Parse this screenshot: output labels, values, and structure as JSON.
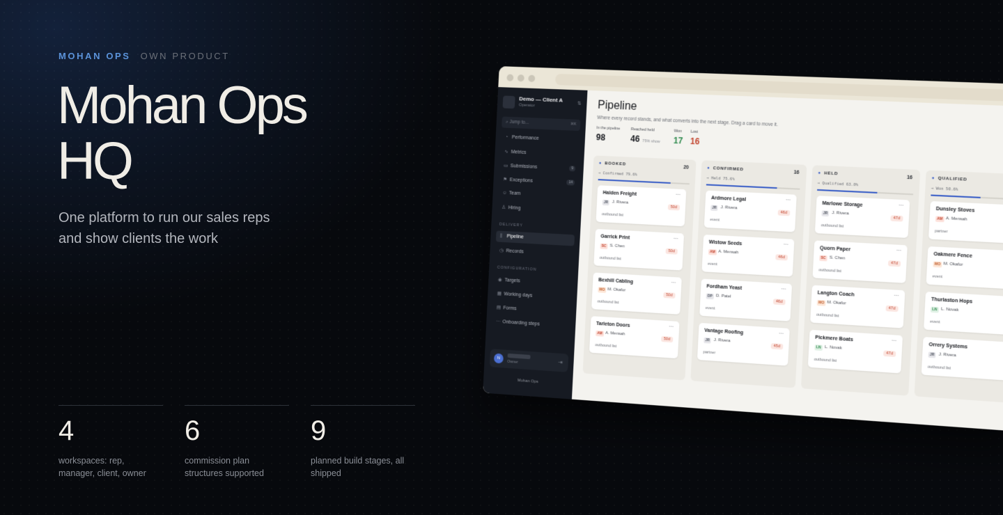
{
  "eyebrow": {
    "brand": "MOHAN OPS",
    "tag": "OWN PRODUCT"
  },
  "hero": {
    "title_line1": "Mohan Ops",
    "title_line2": "HQ",
    "subtitle": "One platform to run our sales reps and show clients the work"
  },
  "stats": [
    {
      "value": "4",
      "label": "workspaces: rep, manager, client, owner"
    },
    {
      "value": "6",
      "label": "commission plan structures supported"
    },
    {
      "value": "9",
      "label": "planned build stages, all shipped"
    }
  ],
  "app": {
    "workspace": {
      "name": "Demo — Client A",
      "role": "Operator"
    },
    "jump_placeholder": "Jump to...",
    "jump_shortcut": "⌘K",
    "nav_top": [
      {
        "label": "Performance",
        "icon": "gauge-icon",
        "glyph": "◔"
      },
      {
        "label": "Metrics",
        "icon": "activity-icon",
        "glyph": "∿"
      },
      {
        "label": "Submissions",
        "icon": "inbox-icon",
        "glyph": "▭",
        "count": "9"
      },
      {
        "label": "Exceptions",
        "icon": "flag-icon",
        "glyph": "⚑",
        "count": "14"
      },
      {
        "label": "Team",
        "icon": "users-icon",
        "glyph": "☺"
      },
      {
        "label": "Hiring",
        "icon": "user-plus-icon",
        "glyph": "♙"
      }
    ],
    "section_delivery": "DELIVERY",
    "nav_delivery": [
      {
        "label": "Pipeline",
        "icon": "kanban-icon",
        "glyph": "⫼",
        "active": true
      },
      {
        "label": "Records",
        "icon": "records-icon",
        "glyph": "◷"
      }
    ],
    "section_config": "CONFIGURATION",
    "nav_config": [
      {
        "label": "Targets",
        "icon": "target-icon",
        "glyph": "◉"
      },
      {
        "label": "Working days",
        "icon": "calendar-icon",
        "glyph": "▦"
      },
      {
        "label": "Forms",
        "icon": "form-icon",
        "glyph": "▤"
      },
      {
        "label": "Onboarding steps",
        "icon": "steps-icon",
        "glyph": "⋯"
      }
    ],
    "user": {
      "initial": "N",
      "role": "Owner"
    },
    "footer": "Mohan Ops",
    "page": {
      "title": "Pipeline",
      "subtitle": "Where every record stands, and what converts into the next stage. Drag a card to move it.",
      "metrics": [
        {
          "label": "In the pipeline",
          "value": "98"
        },
        {
          "label": "Reached held",
          "value": "46",
          "note": "75% show"
        },
        {
          "label": "Won",
          "value": "17",
          "tone": "green"
        },
        {
          "label": "Lost",
          "value": "16",
          "tone": "red"
        }
      ]
    },
    "columns": [
      {
        "name": "BOOKED",
        "count": "20",
        "rate_text": "→ Confirmed 79.6%",
        "rate": 0.796,
        "cards": [
          {
            "company": "Halden Freight",
            "initials": "JR",
            "owner": "J. Rivera",
            "age": "50d",
            "source": "outbound list"
          },
          {
            "company": "Garrick Print",
            "initials": "SC",
            "owner": "S. Chen",
            "age": "50d",
            "source": "outbound list"
          },
          {
            "company": "Bexhill Cabling",
            "initials": "MO",
            "owner": "M. Okafor",
            "age": "50d",
            "source": "outbound list"
          },
          {
            "company": "Tarleton Doors",
            "initials": "AM",
            "owner": "A. Mensah",
            "age": "50d",
            "source": "outbound list"
          }
        ]
      },
      {
        "name": "CONFIRMED",
        "count": "16",
        "rate_text": "→ Held 75.6%",
        "rate": 0.756,
        "cards": [
          {
            "company": "Ardmore Legal",
            "initials": "JR",
            "owner": "J. Rivera",
            "age": "46d",
            "source": "event"
          },
          {
            "company": "Wistow Seeds",
            "initials": "AM",
            "owner": "A. Mensah",
            "age": "46d",
            "source": "event"
          },
          {
            "company": "Fordham Yeast",
            "initials": "DP",
            "owner": "D. Patel",
            "age": "46d",
            "source": "event"
          },
          {
            "company": "Vantage Roofing",
            "initials": "JR",
            "owner": "J. Rivera",
            "age": "45d",
            "source": "partner"
          }
        ]
      },
      {
        "name": "HELD",
        "count": "16",
        "rate_text": "→ Qualified 63.0%",
        "rate": 0.63,
        "cards": [
          {
            "company": "Marlowe Storage",
            "initials": "JR",
            "owner": "J. Rivera",
            "age": "47d",
            "source": "outbound list"
          },
          {
            "company": "Quorn Paper",
            "initials": "SC",
            "owner": "S. Chen",
            "age": "47d",
            "source": "outbound list"
          },
          {
            "company": "Langton Coach",
            "initials": "MO",
            "owner": "M. Okafor",
            "age": "47d",
            "source": "outbound list"
          },
          {
            "company": "Pickmere Boats",
            "initials": "LN",
            "owner": "L. Novak",
            "age": "47d",
            "source": "outbound list"
          }
        ]
      },
      {
        "name": "QUALIFIED",
        "count": "",
        "rate_text": "→ Won 50.6%",
        "rate": 0.506,
        "cards": [
          {
            "company": "Dunsley Stoves",
            "initials": "AM",
            "owner": "A. Mensah",
            "age": "",
            "source": "partner"
          },
          {
            "company": "Oakmere Fence",
            "initials": "MO",
            "owner": "M. Okafor",
            "age": "",
            "source": "event"
          },
          {
            "company": "Thurlaston Hops",
            "initials": "LN",
            "owner": "L. Novak",
            "age": "",
            "source": "event"
          },
          {
            "company": "Orrery Systems",
            "initials": "JR",
            "owner": "J. Rivera",
            "age": "",
            "source": "outbound list"
          }
        ]
      }
    ]
  },
  "colors": {
    "accent_blue": "#5b93da",
    "stage_blue": "#3b5fc7",
    "won_green": "#2f8a4e",
    "lost_red": "#c2452f",
    "initials": {
      "JR": [
        "#e6e6ea",
        "#555a66"
      ],
      "SC": [
        "#fde2dc",
        "#c2452f"
      ],
      "MO": [
        "#fde7d8",
        "#c2602f"
      ],
      "AM": [
        "#fde2dc",
        "#c2452f"
      ],
      "DP": [
        "#e6e6ea",
        "#555a66"
      ],
      "LN": [
        "#e0f1e5",
        "#2f8a4e"
      ]
    }
  }
}
